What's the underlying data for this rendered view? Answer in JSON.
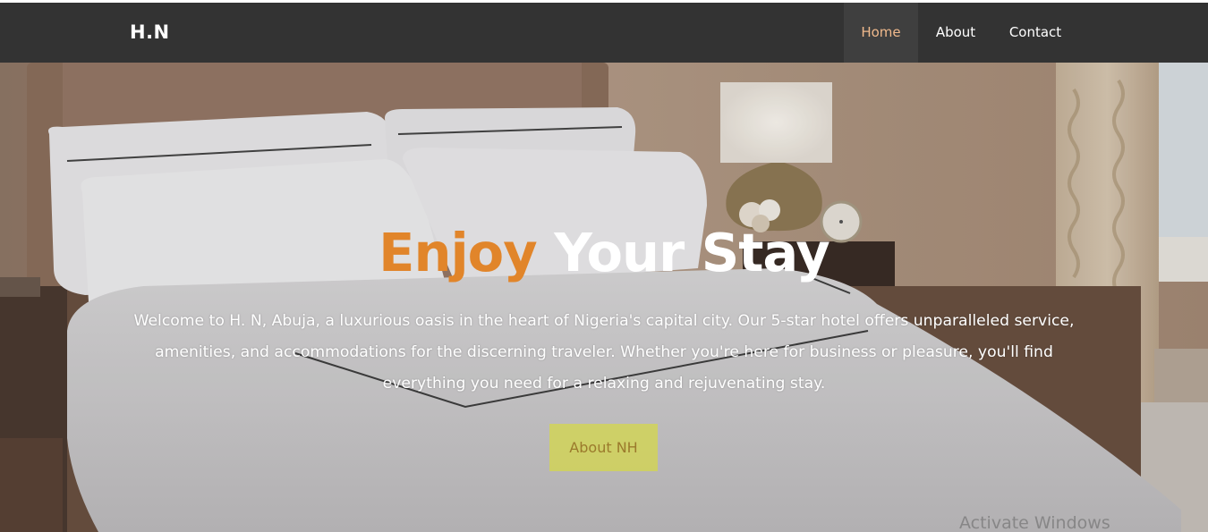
{
  "brand": {
    "logo_text": "H.N"
  },
  "nav": {
    "items": [
      {
        "label": "Home",
        "active": true
      },
      {
        "label": "About",
        "active": false
      },
      {
        "label": "Contact",
        "active": false
      }
    ]
  },
  "hero": {
    "title_accent": "Enjoy",
    "title_rest": "Your Stay",
    "description": "Welcome to H. N, Abuja, a luxurious oasis in the heart of Nigeria's capital city. Our 5-star hotel offers unparalleled service, amenities, and accommodations for the discerning traveler. Whether you're here for business or pleasure, you'll find everything you need for a relaxing and rejuvenating stay.",
    "cta_label": "About NH",
    "background_image": "hotel-bedroom-photo"
  },
  "system_overlay": {
    "watermark_text": "Activate Windows"
  },
  "colors": {
    "navbar_bg": "#333333",
    "nav_active_text": "#f0b98c",
    "title_accent": "#e1852a",
    "cta_bg": "#d4d650",
    "cta_text": "#9b7a2c"
  }
}
